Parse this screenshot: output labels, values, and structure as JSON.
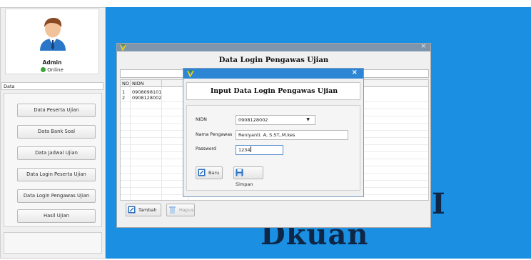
{
  "sidebar": {
    "username": "Admin",
    "status": "Online",
    "section_label": "Data",
    "menu": [
      "Data Peserta Ujian",
      "Data Bank Soal",
      "Data Jadwal Ujian",
      "Data Login Peserta Ujian",
      "Data Login Pengawas Ujian",
      "Hasil Ujian"
    ]
  },
  "background_text": {
    "big": "Dkuan"
  },
  "outer_window": {
    "title": "Data Login Pengawas Ujian",
    "close_glyph": "×",
    "columns": [
      "NO",
      "NIDN"
    ],
    "rows": [
      {
        "no": "1",
        "nidn": "0908098101"
      },
      {
        "no": "2",
        "nidn": "0908128002"
      }
    ],
    "buttons": {
      "add": "Tambah",
      "delete": "Hapus"
    }
  },
  "dialog": {
    "title": "Input Data Login Pengawas Ujian",
    "close_glyph": "×",
    "fields": {
      "nidn_label": "NIDN",
      "nidn_value": "0908128002",
      "name_label": "Nama Pengawas",
      "name_value": "Reniyanti. A, S.ST.,M.kes",
      "password_label": "Password",
      "password_value": "1234"
    },
    "buttons": {
      "new": "Baru",
      "save": "Simpan"
    }
  },
  "colors": {
    "desktop": "#1b8fe2",
    "dialog_titlebar": "#2c86d4",
    "online": "#3aa535"
  }
}
